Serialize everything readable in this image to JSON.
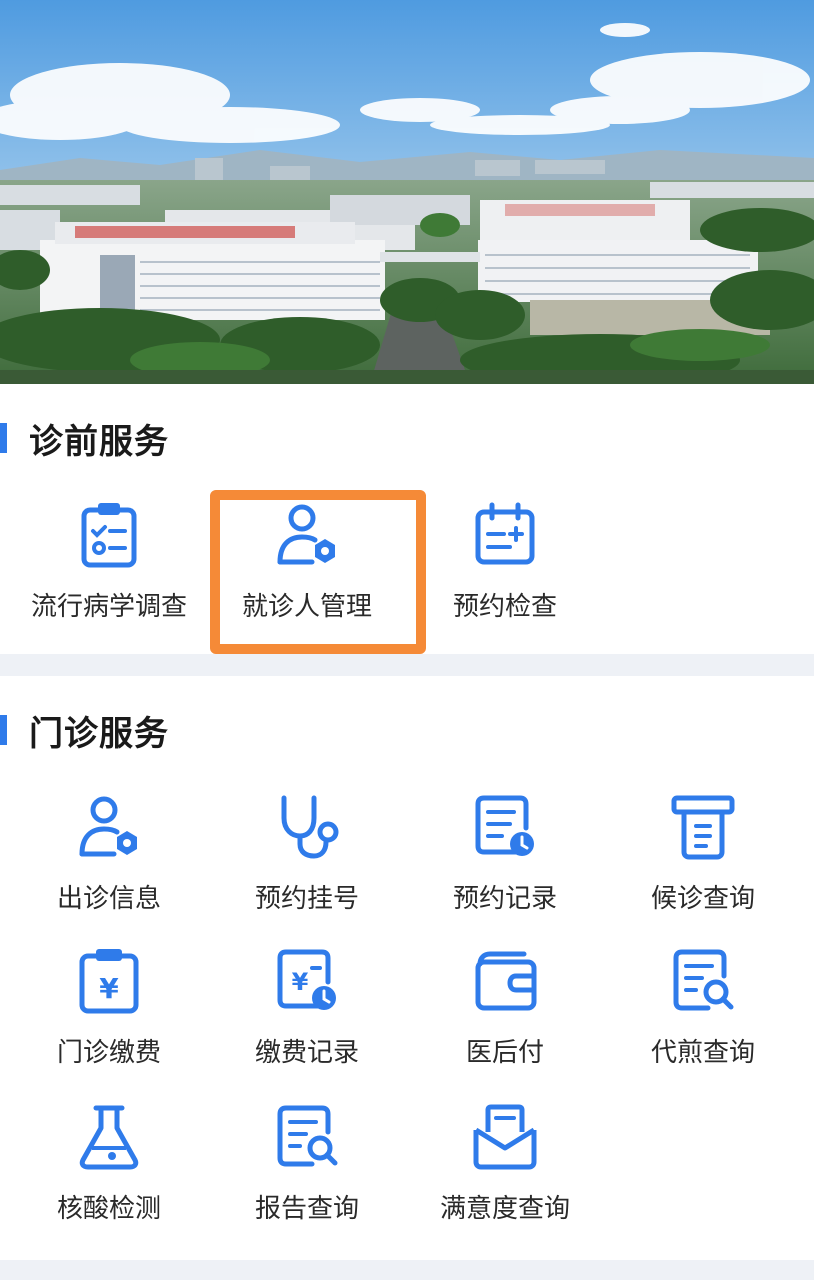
{
  "sections": {
    "pre_visit": {
      "title": "诊前服务",
      "items": [
        {
          "label": "流行病学调查",
          "icon": "survey-clipboard-icon"
        },
        {
          "label": "就诊人管理",
          "icon": "patient-management-icon"
        },
        {
          "label": "预约检查",
          "icon": "calendar-add-icon"
        }
      ]
    },
    "outpatient": {
      "title": "门诊服务",
      "items": [
        {
          "label": "出诊信息",
          "icon": "doctor-info-icon"
        },
        {
          "label": "预约挂号",
          "icon": "stethoscope-icon"
        },
        {
          "label": "预约记录",
          "icon": "record-clock-icon"
        },
        {
          "label": "候诊查询",
          "icon": "queue-ticket-icon"
        },
        {
          "label": "门诊缴费",
          "icon": "payment-clipboard-icon"
        },
        {
          "label": "缴费记录",
          "icon": "payment-record-icon"
        },
        {
          "label": "医后付",
          "icon": "wallet-icon"
        },
        {
          "label": "代煎查询",
          "icon": "document-search-icon"
        },
        {
          "label": "核酸检测",
          "icon": "flask-icon"
        },
        {
          "label": "报告查询",
          "icon": "report-search-icon"
        },
        {
          "label": "满意度查询",
          "icon": "envelope-icon"
        }
      ]
    }
  },
  "colors": {
    "accent": "#2f7bea",
    "highlight": "#f58a37",
    "background": "#eef1f6"
  }
}
